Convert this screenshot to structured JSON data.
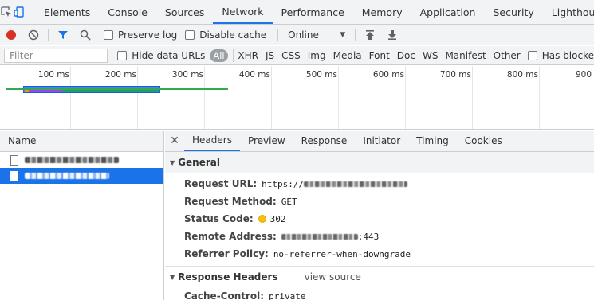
{
  "tabs": [
    "Elements",
    "Console",
    "Sources",
    "Network",
    "Performance",
    "Memory",
    "Application",
    "Security",
    "Lighthouse"
  ],
  "active_tab": "Network",
  "toolbar": {
    "preserve_log": "Preserve log",
    "disable_cache": "Disable cache",
    "throttle": "Online"
  },
  "filter": {
    "placeholder": "Filter",
    "hide_data_urls": "Hide data URLs",
    "all": "All",
    "types": [
      "XHR",
      "JS",
      "CSS",
      "Img",
      "Media",
      "Font",
      "Doc",
      "WS",
      "Manifest",
      "Other"
    ],
    "has_blocked": "Has blocke"
  },
  "timeline": {
    "ticks": [
      "100 ms",
      "200 ms",
      "300 ms",
      "400 ms",
      "500 ms",
      "600 ms",
      "700 ms",
      "800 ms",
      "900"
    ]
  },
  "requests": {
    "header": "Name"
  },
  "details": {
    "tabs": [
      "Headers",
      "Preview",
      "Response",
      "Initiator",
      "Timing",
      "Cookies"
    ],
    "active_tab": "Headers",
    "general_title": "General",
    "general": {
      "request_url_key": "Request URL:",
      "request_url_val": "https://",
      "method_key": "Request Method:",
      "method_val": "GET",
      "status_key": "Status Code:",
      "status_val": "302",
      "remote_key": "Remote Address:",
      "remote_val": ":443",
      "referrer_key": "Referrer Policy:",
      "referrer_val": "no-referrer-when-downgrade"
    },
    "response_title": "Response Headers",
    "view_source": "view source",
    "cache_key": "Cache-Control:",
    "cache_val": "private"
  },
  "colors": {
    "accent": "#1a73e8",
    "record": "#d93025",
    "status_dot": "#f4c20d"
  }
}
